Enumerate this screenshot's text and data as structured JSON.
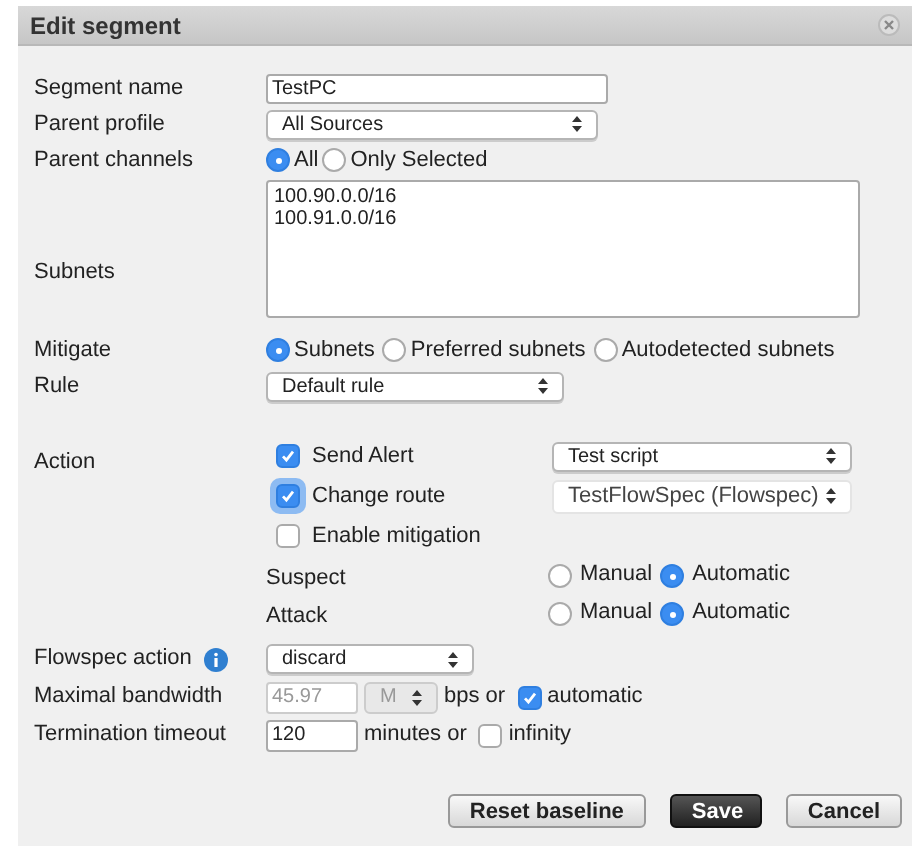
{
  "window": {
    "title": "Edit segment"
  },
  "segment_name": {
    "label": "Segment name",
    "value": "TestPC"
  },
  "parent_profile": {
    "label": "Parent profile",
    "value": "All Sources"
  },
  "parent_channels": {
    "label": "Parent channels",
    "options": [
      {
        "label": "All",
        "selected": true
      },
      {
        "label": "Only Selected",
        "selected": false
      }
    ]
  },
  "subnets": {
    "label": "Subnets",
    "lines": [
      "100.90.0.0/16",
      "100.91.0.0/16"
    ]
  },
  "mitigate": {
    "label": "Mitigate",
    "options": [
      {
        "label": "Subnets",
        "selected": true
      },
      {
        "label": "Preferred subnets",
        "selected": false
      },
      {
        "label": "Autodetected subnets",
        "selected": false
      }
    ]
  },
  "rule": {
    "label": "Rule",
    "value": "Default rule"
  },
  "action": {
    "label": "Action",
    "items": [
      {
        "label": "Send Alert",
        "checked": true,
        "focused": false,
        "select": {
          "value": "Test script",
          "disabled": false
        }
      },
      {
        "label": "Change route",
        "checked": true,
        "focused": true,
        "select": {
          "value": "TestFlowSpec (Flowspec)",
          "disabled": true
        }
      },
      {
        "label": "Enable mitigation",
        "checked": false,
        "focused": false
      }
    ],
    "modes": [
      {
        "label": "Suspect",
        "options": [
          {
            "label": "Manual",
            "selected": false
          },
          {
            "label": "Automatic",
            "selected": true
          }
        ]
      },
      {
        "label": "Attack",
        "options": [
          {
            "label": "Manual",
            "selected": false
          },
          {
            "label": "Automatic",
            "selected": true
          }
        ]
      }
    ]
  },
  "flowspec_action": {
    "label": "Flowspec action",
    "value": "discard"
  },
  "maximal_bandwidth": {
    "label": "Maximal bandwidth",
    "placeholder": "45.97",
    "unit": "M",
    "disabled": true,
    "suffix": "bps or",
    "automatic": {
      "label": "automatic",
      "checked": true
    }
  },
  "termination_timeout": {
    "label": "Termination timeout",
    "value": "120",
    "suffix": "minutes or",
    "infinity": {
      "label": "infinity",
      "checked": false
    }
  },
  "buttons": [
    {
      "label": "Reset baseline",
      "kind": "default"
    },
    {
      "label": "Save",
      "kind": "primary"
    },
    {
      "label": "Cancel",
      "kind": "default"
    }
  ]
}
